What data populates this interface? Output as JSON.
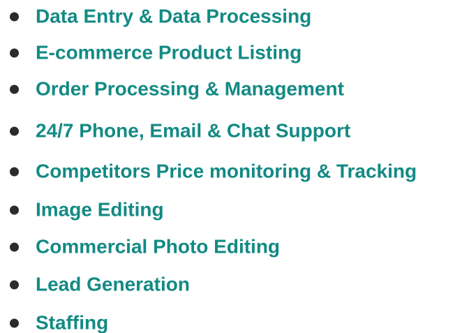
{
  "services": {
    "items": [
      {
        "label": "Data Entry & Data Processing"
      },
      {
        "label": "E-commerce Product Listing"
      },
      {
        "label": "Order Processing & Management"
      },
      {
        "label": "24/7 Phone, Email & Chat Support"
      },
      {
        "label": "Competitors Price monitoring & Tracking"
      },
      {
        "label": "Image Editing"
      },
      {
        "label": "Commercial Photo Editing"
      },
      {
        "label": "Lead Generation"
      },
      {
        "label": "Staffing"
      }
    ],
    "text_color": "#138a84",
    "bullet_color": "#2b2b2b"
  }
}
